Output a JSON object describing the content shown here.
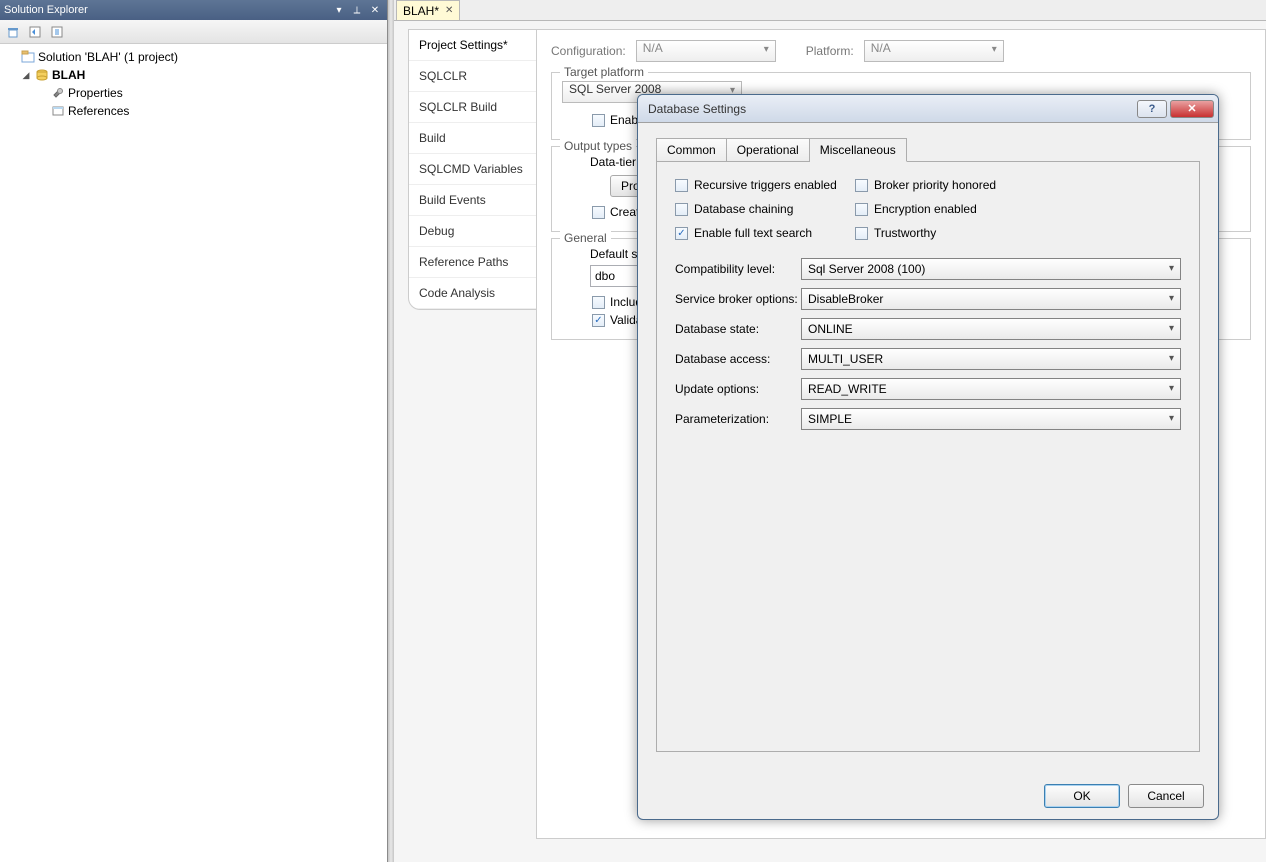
{
  "solution_explorer": {
    "title": "Solution Explorer",
    "solution_label": "Solution 'BLAH' (1 project)",
    "project_label": "BLAH",
    "properties_label": "Properties",
    "references_label": "References"
  },
  "doc_tab": {
    "label": "BLAH*"
  },
  "project_settings": {
    "nav": {
      "project_settings": "Project Settings*",
      "sqlclr": "SQLCLR",
      "sqlclr_build": "SQLCLR Build",
      "build": "Build",
      "sqlcmd_vars": "SQLCMD Variables",
      "build_events": "Build Events",
      "debug": "Debug",
      "reference_paths": "Reference Paths",
      "code_analysis": "Code Analysis"
    },
    "configuration_label": "Configuration:",
    "configuration_value": "N/A",
    "platform_label": "Platform:",
    "platform_value": "N/A",
    "target_platform_legend": "Target platform",
    "target_platform_value": "SQL Server 2008",
    "enable_check": "Enable",
    "output_types_legend": "Output types",
    "data_tier_label": "Data-tier",
    "properties_button": "Prop",
    "create_check": "Create",
    "general_legend": "General",
    "default_schema_label": "Default sc",
    "default_schema_value": "dbo",
    "include_check": "Includ",
    "validate_check": "Validat"
  },
  "dialog": {
    "title": "Database Settings",
    "tabs": {
      "common": "Common",
      "operational": "Operational",
      "miscellaneous": "Miscellaneous"
    },
    "checks": {
      "recursive_triggers": "Recursive triggers enabled",
      "broker_priority": "Broker priority honored",
      "database_chaining": "Database chaining",
      "encryption_enabled": "Encryption enabled",
      "full_text_search": "Enable full text search",
      "trustworthy": "Trustworthy"
    },
    "check_values": {
      "recursive_triggers": false,
      "broker_priority": false,
      "database_chaining": false,
      "encryption_enabled": false,
      "full_text_search": true,
      "trustworthy": false
    },
    "fields": {
      "compatibility_label": "Compatibility level:",
      "compatibility_value": "Sql Server 2008 (100)",
      "service_broker_label": "Service broker options:",
      "service_broker_value": "DisableBroker",
      "database_state_label": "Database state:",
      "database_state_value": "ONLINE",
      "database_access_label": "Database access:",
      "database_access_value": "MULTI_USER",
      "update_options_label": "Update options:",
      "update_options_value": "READ_WRITE",
      "parameterization_label": "Parameterization:",
      "parameterization_value": "SIMPLE"
    },
    "buttons": {
      "ok": "OK",
      "cancel": "Cancel"
    }
  }
}
